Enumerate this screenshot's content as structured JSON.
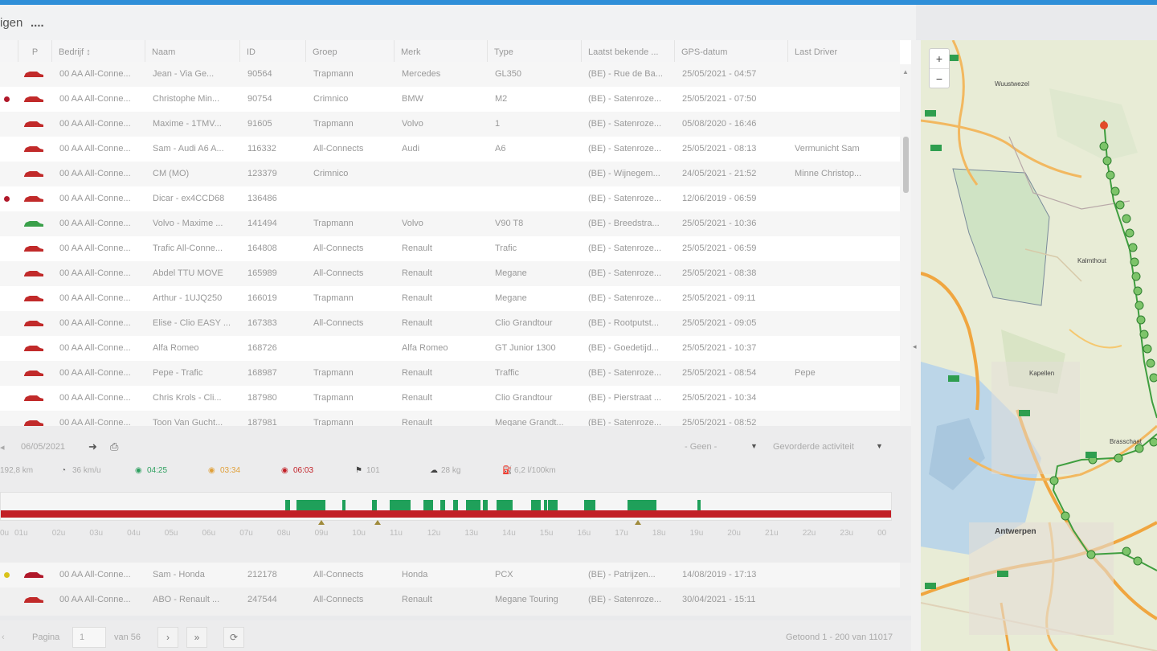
{
  "window": {
    "title": "igen",
    "menu_dots": "...."
  },
  "grid": {
    "headers": [
      "P",
      "Bedrijf",
      "Naam",
      "ID",
      "Groep",
      "Merk",
      "Type",
      "Laatst bekende ...",
      "GPS-datum",
      "Last Driver"
    ],
    "sort_indicator": "↕",
    "rows": [
      {
        "dot": "",
        "car": "#c12a2a",
        "company": "00 AA All-Conne...",
        "name": "Jean - Via Ge...",
        "id": "90564",
        "group": "Trapmann",
        "brand": "Mercedes",
        "type": "GL350",
        "location": "(BE) - Rue de Ba...",
        "gps": "25/05/2021 - 04:57",
        "driver": ""
      },
      {
        "dot": "#b0182a",
        "car": "#c12a2a",
        "company": "00 AA All-Conne...",
        "name": "Christophe Min...",
        "id": "90754",
        "group": "Crimnico",
        "brand": "BMW",
        "type": "M2",
        "location": "(BE) - Satenroze...",
        "gps": "25/05/2021 - 07:50",
        "driver": ""
      },
      {
        "dot": "",
        "car": "#c12a2a",
        "company": "00 AA All-Conne...",
        "name": "Maxime - 1TMV...",
        "id": "91605",
        "group": "Trapmann",
        "brand": "Volvo",
        "type": "1",
        "location": "(BE) - Satenroze...",
        "gps": "05/08/2020 - 16:46",
        "driver": ""
      },
      {
        "dot": "",
        "car": "#c12a2a",
        "company": "00 AA All-Conne...",
        "name": "Sam - Audi A6 A...",
        "id": "116332",
        "group": "All-Connects",
        "brand": "Audi",
        "type": "A6",
        "location": "(BE) - Satenroze...",
        "gps": "25/05/2021 - 08:13",
        "driver": "Vermunicht Sam"
      },
      {
        "dot": "",
        "car": "#c12a2a",
        "company": "00 AA All-Conne...",
        "name": "CM (MO)",
        "id": "123379",
        "group": "Crimnico",
        "brand": "",
        "type": "",
        "location": "(BE) - Wijnegem...",
        "gps": "24/05/2021 - 21:52",
        "driver": "Minne Christop..."
      },
      {
        "dot": "#b0182a",
        "car": "#c12a2a",
        "company": "00 AA All-Conne...",
        "name": "Dicar - ex4CCD68",
        "id": "136486",
        "group": "",
        "brand": "",
        "type": "",
        "location": "(BE) - Satenroze...",
        "gps": "12/06/2019 - 06:59",
        "driver": ""
      },
      {
        "dot": "",
        "car": "#3aa04a",
        "company": "00 AA All-Conne...",
        "name": "Volvo - Maxime ...",
        "id": "141494",
        "group": "Trapmann",
        "brand": "Volvo",
        "type": "V90 T8",
        "location": "(BE) - Breedstra...",
        "gps": "25/05/2021 - 10:36",
        "driver": ""
      },
      {
        "dot": "",
        "car": "#c12a2a",
        "company": "00 AA All-Conne...",
        "name": "Trafic All-Conne...",
        "id": "164808",
        "group": "All-Connects",
        "brand": "Renault",
        "type": "Trafic",
        "location": "(BE) - Satenroze...",
        "gps": "25/05/2021 - 06:59",
        "driver": ""
      },
      {
        "dot": "",
        "car": "#c12a2a",
        "company": "00 AA All-Conne...",
        "name": "Abdel TTU MOVE",
        "id": "165989",
        "group": "All-Connects",
        "brand": "Renault",
        "type": "Megane",
        "location": "(BE) - Satenroze...",
        "gps": "25/05/2021 - 08:38",
        "driver": ""
      },
      {
        "dot": "",
        "car": "#c12a2a",
        "company": "00 AA All-Conne...",
        "name": "Arthur - 1UJQ250",
        "id": "166019",
        "group": "Trapmann",
        "brand": "Renault",
        "type": "Megane",
        "location": "(BE) - Satenroze...",
        "gps": "25/05/2021 - 09:11",
        "driver": ""
      },
      {
        "dot": "",
        "car": "#c12a2a",
        "company": "00 AA All-Conne...",
        "name": "Elise - Clio EASY ...",
        "id": "167383",
        "group": "All-Connects",
        "brand": "Renault",
        "type": "Clio Grandtour",
        "location": "(BE) - Rootputst...",
        "gps": "25/05/2021 - 09:05",
        "driver": ""
      },
      {
        "dot": "",
        "car": "#c12a2a",
        "company": "00 AA All-Conne...",
        "name": "Alfa Romeo",
        "id": "168726",
        "group": "",
        "brand": "Alfa Romeo",
        "type": "GT Junior 1300",
        "location": "(BE) - Goedetijd...",
        "gps": "25/05/2021 - 10:37",
        "driver": ""
      },
      {
        "dot": "",
        "car": "#c12a2a",
        "company": "00 AA All-Conne...",
        "name": "Pepe - Trafic",
        "id": "168987",
        "group": "Trapmann",
        "brand": "Renault",
        "type": "Traffic",
        "location": "(BE) - Satenroze...",
        "gps": "25/05/2021 - 08:54",
        "driver": "Pepe"
      },
      {
        "dot": "",
        "car": "#c12a2a",
        "company": "00 AA All-Conne...",
        "name": "Chris Krols - Cli...",
        "id": "187980",
        "group": "Trapmann",
        "brand": "Renault",
        "type": "Clio Grandtour",
        "location": "(BE) - Pierstraat ...",
        "gps": "25/05/2021 - 10:34",
        "driver": ""
      },
      {
        "dot": "",
        "car": "#c12a2a",
        "company": "00 AA All-Conne...",
        "name": "Toon Van Gucht...",
        "id": "187981",
        "group": "Trapmann",
        "brand": "Renault",
        "type": "Megane Grandt...",
        "location": "(BE) - Satenroze...",
        "gps": "25/05/2021 - 08:52",
        "driver": ""
      }
    ]
  },
  "detail": {
    "date": "06/05/2021",
    "filter": "- Geen -",
    "activity": "Gevorderde activiteit",
    "stats": {
      "distance": "192,8 km",
      "speed": "36 km/u",
      "driving": "04:25",
      "idle": "03:34",
      "stopped": "06:03",
      "stops": "101",
      "co2": "28 kg",
      "consumption": "6,2 l/100km"
    },
    "hours": [
      "0u",
      "01u",
      "02u",
      "03u",
      "04u",
      "05u",
      "06u",
      "07u",
      "08u",
      "09u",
      "10u",
      "11u",
      "12u",
      "13u",
      "14u",
      "15u",
      "16u",
      "17u",
      "18u",
      "19u",
      "20u",
      "21u",
      "22u",
      "23u",
      "00"
    ]
  },
  "grid2": {
    "rows": [
      {
        "dot": "#d9c21a",
        "car": "#b0182a",
        "company": "00 AA All-Conne...",
        "name": "Sam - Honda",
        "id": "212178",
        "group": "All-Connects",
        "brand": "Honda",
        "type": "PCX",
        "location": "(BE) - Patrijzen...",
        "gps": "14/08/2019 - 17:13",
        "driver": ""
      },
      {
        "dot": "",
        "car": "#c12a2a",
        "company": "00 AA All-Conne...",
        "name": "ABO - Renault ...",
        "id": "247544",
        "group": "All-Connects",
        "brand": "Renault",
        "type": "Megane Touring",
        "location": "(BE) - Satenroze...",
        "gps": "30/04/2021 - 15:11",
        "driver": ""
      }
    ]
  },
  "pager": {
    "label": "Pagina",
    "page": "1",
    "of": "van 56",
    "summary": "Getoond 1 - 200 van 11017"
  },
  "map": {
    "zoom_in": "+",
    "zoom_out": "−",
    "city": "Antwerpen",
    "labels": [
      "Wuustwezel",
      "Kalmthout",
      "Brasschaat",
      "Kapellen"
    ]
  },
  "colors": {
    "accent": "#2f8fd8",
    "stopped": "#c21f26",
    "driving": "#1fa05a"
  }
}
